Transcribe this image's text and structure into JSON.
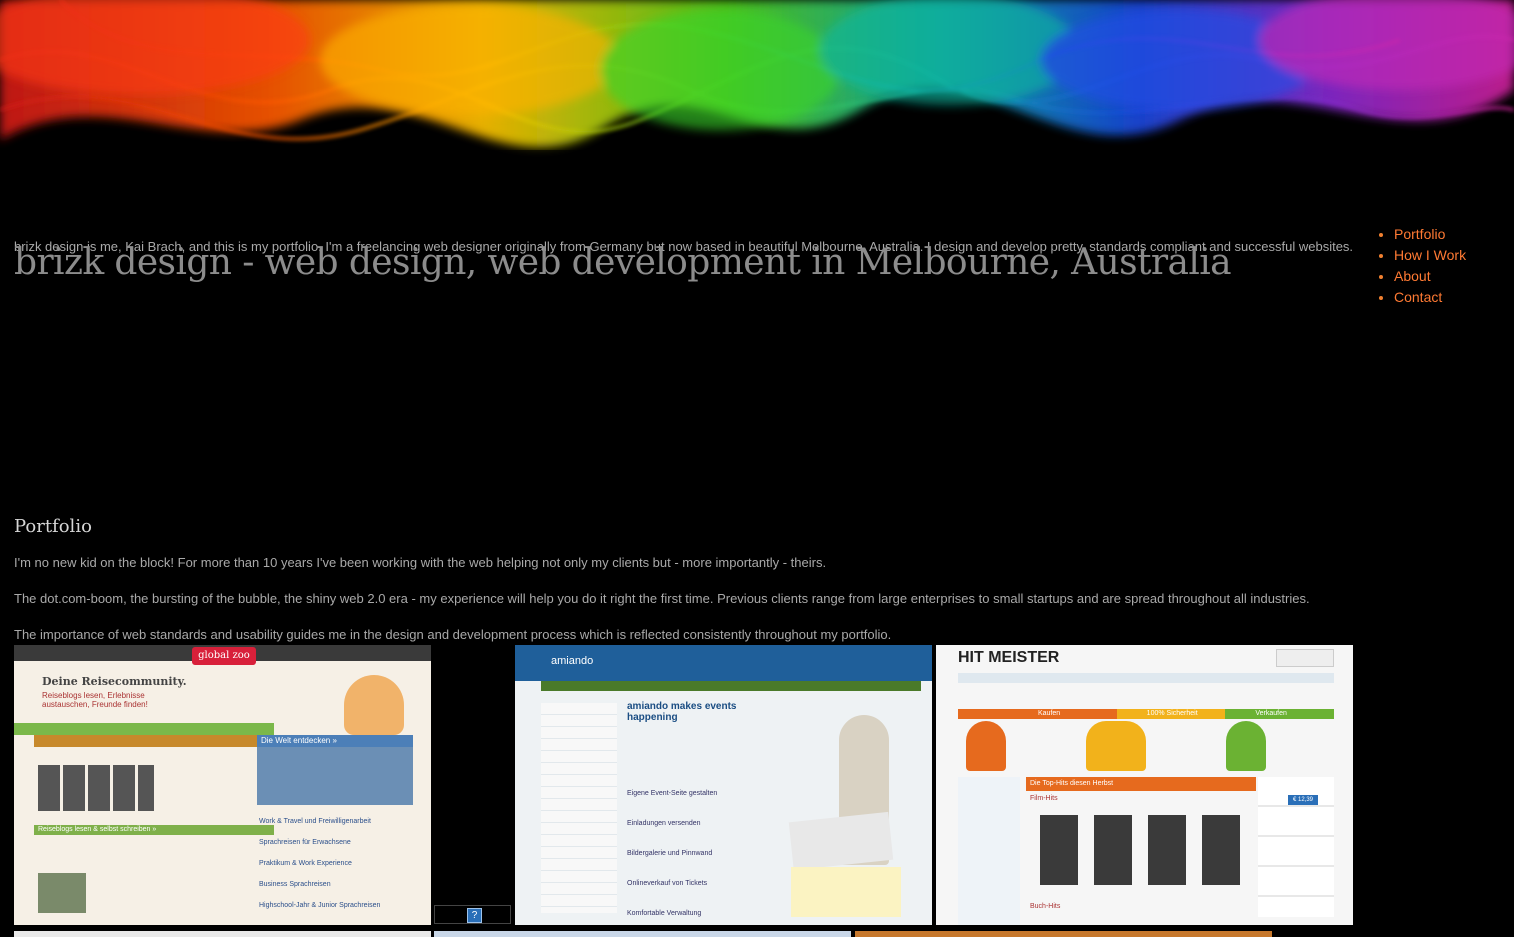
{
  "intro_text": "brizk design is me, Kai Brach, and this is my portfolio. I'm a freelancing web designer originally from Germany but now based in beautiful Melbourne, Australia. I design and develop pretty, standards compliant and successful websites.",
  "site_title": "brizk design - web design, web development in Melbourne, Australia",
  "nav": {
    "items": [
      {
        "label": "Portfolio"
      },
      {
        "label": "How I Work"
      },
      {
        "label": "About"
      },
      {
        "label": "Contact"
      }
    ]
  },
  "portfolio": {
    "heading": "Portfolio",
    "paragraphs": [
      "I'm no new kid on the block! For more than 10 years I've been working with the web helping not only my clients but - more importantly - theirs.",
      "The dot.com-boom, the bursting of the bubble, the shiny web 2.0 era - my experience will help you do it right the first time. Previous clients range from large enterprises to small startups and are spread throughout all industries.",
      "The importance of web standards and usability guides me in the design and development process which is reflected consistently throughout my portfolio."
    ],
    "thumbnails": [
      {
        "logo": "global zoo",
        "headline": "Deine Reisecommunity.",
        "tagline": "Reiseblogs lesen, Erlebnisse austauschen, Freunde finden!",
        "sections": [
          "Die Welt entdecken »",
          "Reiseblogs lesen & selbst schreiben »"
        ],
        "links": [
          "Work & Travel und Freiwilligenarbeit",
          "Sprachreisen für Erwachsene",
          "Praktikum & Work Experience",
          "Business Sprachreisen",
          "Highschool-Jahr & Junior Sprachreisen"
        ]
      },
      {
        "logo": "amiando",
        "headline": "amiando makes events happening",
        "items": [
          "Eigene Event-Seite gestalten",
          "Einladungen versenden",
          "Bildergalerie und Pinnwand",
          "Onlineverkauf von Tickets",
          "Komfortable Verwaltung"
        ]
      },
      {
        "logo": "HIT MEISTER",
        "bars": [
          "Kaufen",
          "100% Sicherheit",
          "Verkaufen"
        ],
        "section": "Die Top-Hits diesen Herbst",
        "subsection": "Film-Hits",
        "subsection2": "Buch-Hits",
        "price": "€ 12,39"
      }
    ],
    "missing_image_glyph": "?"
  },
  "colors": {
    "background": "#000000",
    "nav_link": "#ff7a33",
    "title": "#8c8c8c"
  }
}
